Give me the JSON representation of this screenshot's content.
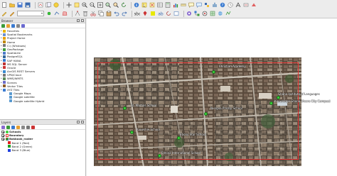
{
  "browser_panel": {
    "title": "Browser",
    "items": [
      {
        "label": "Favorites",
        "icon": "star-icon",
        "color": "#e8b400"
      },
      {
        "label": "Spatial Bookmarks",
        "icon": "bookmark-icon",
        "color": "#6a8fd0"
      },
      {
        "label": "Project Home",
        "icon": "home-icon",
        "color": "#e8a000"
      },
      {
        "label": "Home",
        "icon": "home-icon",
        "color": "#c08800"
      },
      {
        "label": "C:\\ (Windows)",
        "icon": "drive-icon",
        "color": "#777777"
      },
      {
        "label": "GeoPackage",
        "icon": "geopackage-icon",
        "color": "#3a9e3a"
      },
      {
        "label": "SpatiaLite",
        "icon": "spatialite-icon",
        "color": "#4a7ac8"
      },
      {
        "label": "PostgreSQL",
        "icon": "postgresql-icon",
        "color": "#336699"
      },
      {
        "label": "SAP HANA",
        "icon": "hana-icon",
        "color": "#3377cc"
      },
      {
        "label": "MS SQL Server",
        "icon": "mssql-icon",
        "color": "#bb3333"
      },
      {
        "label": "Oracle",
        "icon": "oracle-icon",
        "color": "#cc3333"
      },
      {
        "label": "ArcGIS REST Servers",
        "icon": "arcgis-icon",
        "color": "#3a8ad0"
      },
      {
        "label": "VPN/Cloud",
        "icon": "cloud-icon",
        "color": "#777777"
      },
      {
        "label": "WMS/WMTS",
        "icon": "wms-icon",
        "color": "#5a8a5a"
      },
      {
        "label": "Scenes",
        "icon": "scenes-icon",
        "color": "#6a6ac8"
      },
      {
        "label": "Vector Tiles",
        "icon": "vector-tiles-icon",
        "color": "#8a5a2a"
      },
      {
        "label": "XYZ Tiles",
        "icon": "xyz-tiles-icon",
        "color": "#3a7ad0"
      },
      {
        "label": "Google Maps",
        "icon": "tile-layer-icon",
        "color": "#5a9ad0",
        "child": true
      },
      {
        "label": "Google satellite",
        "icon": "tile-layer-icon",
        "color": "#5a9ad0",
        "child": true
      },
      {
        "label": "Google satellite Hybrid",
        "icon": "tile-layer-icon",
        "color": "#5a9ad0",
        "child": true
      }
    ]
  },
  "layers_panel": {
    "title": "Layers",
    "layers": [
      {
        "label": "Schools",
        "bold": true,
        "checked": true,
        "symbol": "point",
        "color": "#3ad13a",
        "indent": 0
      },
      {
        "label": "Boundary",
        "bold": true,
        "checked": true,
        "symbol": "polygon",
        "color": "#e53030",
        "indent": 0
      },
      {
        "label": "Bokbook_raster",
        "bold": true,
        "checked": true,
        "symbol": "raster",
        "color": "#888888",
        "indent": 0
      },
      {
        "label": "Band 1 (Red)",
        "bold": false,
        "checked": false,
        "symbol": "swatch",
        "color": "#e02020",
        "indent": 1
      },
      {
        "label": "Band 2 (Green)",
        "bold": false,
        "checked": false,
        "symbol": "swatch",
        "color": "#20a020",
        "indent": 1
      },
      {
        "label": "Band 3 (Blue)",
        "bold": false,
        "checked": false,
        "symbol": "swatch",
        "color": "#2040e0",
        "indent": 1
      }
    ]
  },
  "map": {
    "labels": [
      {
        "text": "Christian Academy",
        "style": "light"
      },
      {
        "text": "Languages",
        "style": "dark"
      },
      {
        "text": "Ghana Institute of",
        "style": "light"
      },
      {
        "text": "Knowledge Ghana (Accra City Campus)",
        "style": "light"
      },
      {
        "text": "Nungua Presby School",
        "style": "light"
      },
      {
        "text": "St. Martins School",
        "style": "light"
      },
      {
        "text": "Kaneshie School",
        "style": "light"
      },
      {
        "text": "Ebony Star School",
        "style": "light"
      },
      {
        "text": "Elmina International School",
        "style": "light"
      }
    ],
    "point_color": "#3ad13a",
    "boundary_color": "#e53030"
  },
  "toolbar_icons": [
    "new-project-icon",
    "open-project-icon",
    "save-project-icon",
    "save-as-icon",
    "print-layout-icon",
    "pan-icon",
    "pan-to-selection-icon",
    "zoom-in-icon",
    "zoom-out-icon",
    "zoom-full-icon",
    "zoom-layer-icon",
    "zoom-last-icon",
    "refresh-icon",
    "identify-icon",
    "select-icon",
    "measure-icon",
    "annotation-icon",
    "map-tips-icon",
    "python-console-icon",
    "plugin-icon"
  ]
}
